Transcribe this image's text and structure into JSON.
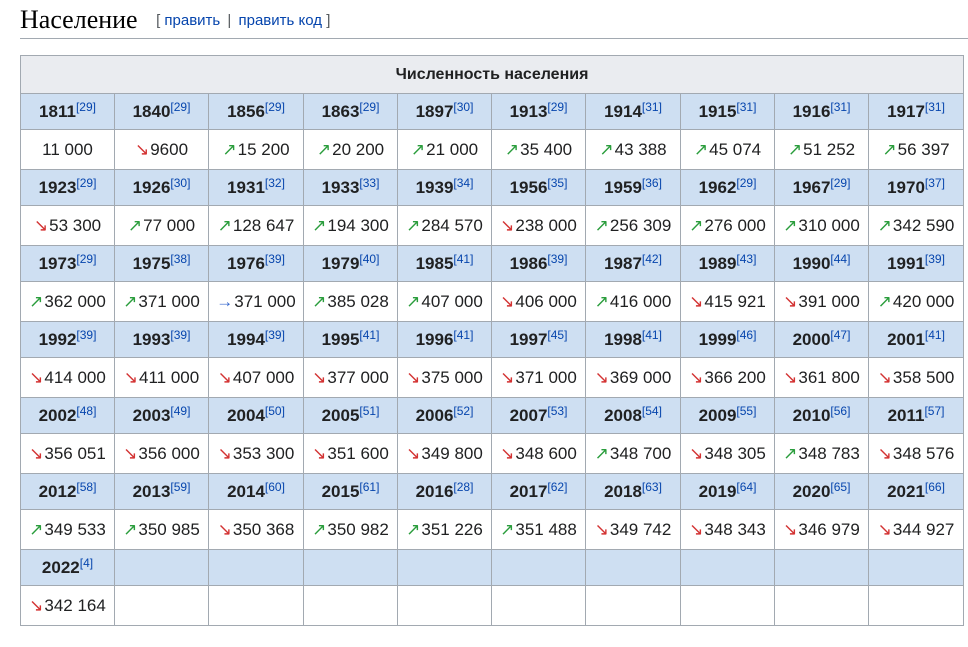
{
  "section": {
    "title": "Население",
    "edit_label": "править",
    "edit_code_label": "править код",
    "bracket_open": "[",
    "bracket_close": "]",
    "separator": "|"
  },
  "table": {
    "caption": "Численность населения",
    "arrow_glyphs": {
      "up": "↗",
      "down": "↘",
      "flat": "→"
    },
    "arrow_colors": {
      "up": "#2a9d3c",
      "down": "#d33333",
      "flat": "#3366cc"
    },
    "rows": [
      [
        {
          "year": "1811",
          "ref": "[29]",
          "value": "11 000",
          "trend": ""
        },
        {
          "year": "1840",
          "ref": "[29]",
          "value": "9600",
          "trend": "down"
        },
        {
          "year": "1856",
          "ref": "[29]",
          "value": "15 200",
          "trend": "up"
        },
        {
          "year": "1863",
          "ref": "[29]",
          "value": "20 200",
          "trend": "up"
        },
        {
          "year": "1897",
          "ref": "[30]",
          "value": "21 000",
          "trend": "up"
        },
        {
          "year": "1913",
          "ref": "[29]",
          "value": "35 400",
          "trend": "up"
        },
        {
          "year": "1914",
          "ref": "[31]",
          "value": "43 388",
          "trend": "up"
        },
        {
          "year": "1915",
          "ref": "[31]",
          "value": "45 074",
          "trend": "up"
        },
        {
          "year": "1916",
          "ref": "[31]",
          "value": "51 252",
          "trend": "up"
        },
        {
          "year": "1917",
          "ref": "[31]",
          "value": "56 397",
          "trend": "up"
        }
      ],
      [
        {
          "year": "1923",
          "ref": "[29]",
          "value": "53 300",
          "trend": "down"
        },
        {
          "year": "1926",
          "ref": "[30]",
          "value": "77 000",
          "trend": "up"
        },
        {
          "year": "1931",
          "ref": "[32]",
          "value": "128 647",
          "trend": "up"
        },
        {
          "year": "1933",
          "ref": "[33]",
          "value": "194 300",
          "trend": "up"
        },
        {
          "year": "1939",
          "ref": "[34]",
          "value": "284 570",
          "trend": "up"
        },
        {
          "year": "1956",
          "ref": "[35]",
          "value": "238 000",
          "trend": "down"
        },
        {
          "year": "1959",
          "ref": "[36]",
          "value": "256 309",
          "trend": "up"
        },
        {
          "year": "1962",
          "ref": "[29]",
          "value": "276 000",
          "trend": "up"
        },
        {
          "year": "1967",
          "ref": "[29]",
          "value": "310 000",
          "trend": "up"
        },
        {
          "year": "1970",
          "ref": "[37]",
          "value": "342 590",
          "trend": "up"
        }
      ],
      [
        {
          "year": "1973",
          "ref": "[29]",
          "value": "362 000",
          "trend": "up"
        },
        {
          "year": "1975",
          "ref": "[38]",
          "value": "371 000",
          "trend": "up"
        },
        {
          "year": "1976",
          "ref": "[39]",
          "value": "371 000",
          "trend": "flat"
        },
        {
          "year": "1979",
          "ref": "[40]",
          "value": "385 028",
          "trend": "up"
        },
        {
          "year": "1985",
          "ref": "[41]",
          "value": "407 000",
          "trend": "up"
        },
        {
          "year": "1986",
          "ref": "[39]",
          "value": "406 000",
          "trend": "down"
        },
        {
          "year": "1987",
          "ref": "[42]",
          "value": "416 000",
          "trend": "up"
        },
        {
          "year": "1989",
          "ref": "[43]",
          "value": "415 921",
          "trend": "down"
        },
        {
          "year": "1990",
          "ref": "[44]",
          "value": "391 000",
          "trend": "down"
        },
        {
          "year": "1991",
          "ref": "[39]",
          "value": "420 000",
          "trend": "up"
        }
      ],
      [
        {
          "year": "1992",
          "ref": "[39]",
          "value": "414 000",
          "trend": "down"
        },
        {
          "year": "1993",
          "ref": "[39]",
          "value": "411 000",
          "trend": "down"
        },
        {
          "year": "1994",
          "ref": "[39]",
          "value": "407 000",
          "trend": "down"
        },
        {
          "year": "1995",
          "ref": "[41]",
          "value": "377 000",
          "trend": "down"
        },
        {
          "year": "1996",
          "ref": "[41]",
          "value": "375 000",
          "trend": "down"
        },
        {
          "year": "1997",
          "ref": "[45]",
          "value": "371 000",
          "trend": "down"
        },
        {
          "year": "1998",
          "ref": "[41]",
          "value": "369 000",
          "trend": "down"
        },
        {
          "year": "1999",
          "ref": "[46]",
          "value": "366 200",
          "trend": "down"
        },
        {
          "year": "2000",
          "ref": "[47]",
          "value": "361 800",
          "trend": "down"
        },
        {
          "year": "2001",
          "ref": "[41]",
          "value": "358 500",
          "trend": "down"
        }
      ],
      [
        {
          "year": "2002",
          "ref": "[48]",
          "value": "356 051",
          "trend": "down"
        },
        {
          "year": "2003",
          "ref": "[49]",
          "value": "356 000",
          "trend": "down"
        },
        {
          "year": "2004",
          "ref": "[50]",
          "value": "353 300",
          "trend": "down"
        },
        {
          "year": "2005",
          "ref": "[51]",
          "value": "351 600",
          "trend": "down"
        },
        {
          "year": "2006",
          "ref": "[52]",
          "value": "349 800",
          "trend": "down"
        },
        {
          "year": "2007",
          "ref": "[53]",
          "value": "348 600",
          "trend": "down"
        },
        {
          "year": "2008",
          "ref": "[54]",
          "value": "348 700",
          "trend": "up"
        },
        {
          "year": "2009",
          "ref": "[55]",
          "value": "348 305",
          "trend": "down"
        },
        {
          "year": "2010",
          "ref": "[56]",
          "value": "348 783",
          "trend": "up"
        },
        {
          "year": "2011",
          "ref": "[57]",
          "value": "348 576",
          "trend": "down"
        }
      ],
      [
        {
          "year": "2012",
          "ref": "[58]",
          "value": "349 533",
          "trend": "up"
        },
        {
          "year": "2013",
          "ref": "[59]",
          "value": "350 985",
          "trend": "up"
        },
        {
          "year": "2014",
          "ref": "[60]",
          "value": "350 368",
          "trend": "down"
        },
        {
          "year": "2015",
          "ref": "[61]",
          "value": "350 982",
          "trend": "up"
        },
        {
          "year": "2016",
          "ref": "[28]",
          "value": "351 226",
          "trend": "up"
        },
        {
          "year": "2017",
          "ref": "[62]",
          "value": "351 488",
          "trend": "up"
        },
        {
          "year": "2018",
          "ref": "[63]",
          "value": "349 742",
          "trend": "down"
        },
        {
          "year": "2019",
          "ref": "[64]",
          "value": "348 343",
          "trend": "down"
        },
        {
          "year": "2020",
          "ref": "[65]",
          "value": "346 979",
          "trend": "down"
        },
        {
          "year": "2021",
          "ref": "[66]",
          "value": "344 927",
          "trend": "down"
        }
      ],
      [
        {
          "year": "2022",
          "ref": "[4]",
          "value": "342 164",
          "trend": "down"
        }
      ]
    ]
  }
}
